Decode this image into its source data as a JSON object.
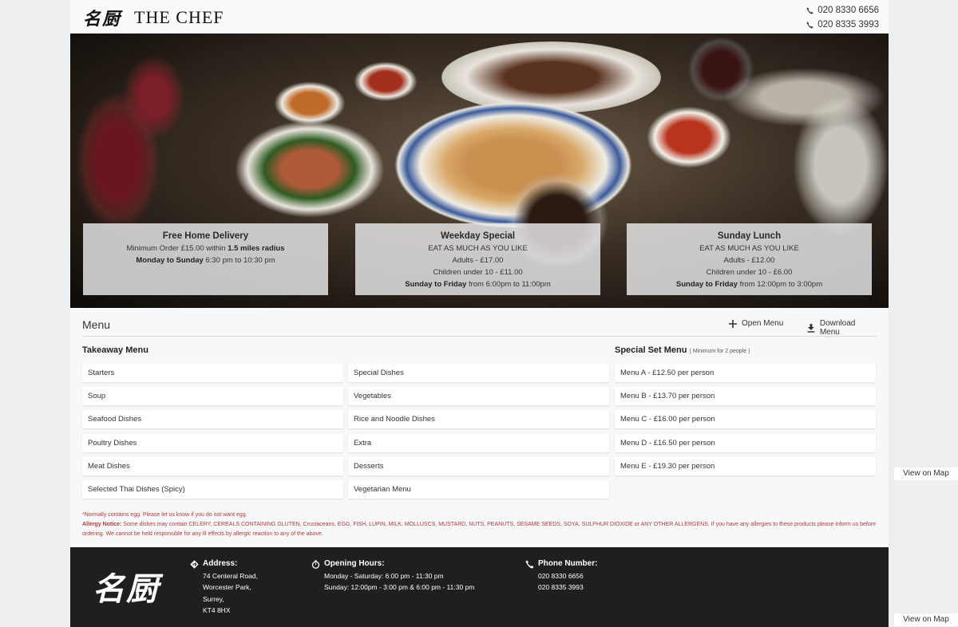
{
  "header": {
    "logo_cn": "名厨",
    "logo_en": "THE CHEF",
    "phones": [
      "020 8330 6656",
      "020 8335 3993"
    ]
  },
  "cards": [
    {
      "title": "Free Home Delivery",
      "line1_pre": "Minimum Order £15.00 within ",
      "line1_bold": "1.5 miles radius",
      "line2_bold": "Monday to Sunday",
      "line2_rest": " 6:30 pm to 10:30 pm"
    },
    {
      "title": "Weekday Special",
      "line1": "EAT AS MUCH AS YOU LIKE",
      "line2": "Adults - £17.00",
      "line3": "Children under 10 - £11.00",
      "line4_bold": "Sunday to Friday",
      "line4_rest": " from 6:00pm to 11:00pm"
    },
    {
      "title": "Sunday Lunch",
      "line1": "EAT AS MUCH AS YOU LIKE",
      "line2": "Adults - £12.00",
      "line3": "Children under 10 - £6.00",
      "line4_bold": "Sunday to Friday",
      "line4_rest": " from 12:00pm to 3:00pm"
    }
  ],
  "menu": {
    "title": "Menu",
    "open_label": "Open Menu",
    "download_label": "Download Menu",
    "takeaway_title": "Takeaway Menu",
    "takeaway_col1": [
      "Starters",
      "Soup",
      "Seafood Dishes",
      "Poultry Dishes",
      "Meat Dishes",
      "Selected Thai Dishes (Spicy)"
    ],
    "takeaway_col2": [
      "Special Dishes",
      "Vegetables",
      "Rice and Noodle Dishes",
      "Extra",
      "Desserts",
      "Vegetarian Menu"
    ],
    "set_title": "Special Set Menu",
    "set_note": "( Minimum for 2 people )",
    "set_items": [
      "Menu A - £12.50 per person",
      "Menu B - £13.70 per person",
      "Menu C - £16.00 per person",
      "Menu D - £16.50 per person",
      "Menu E - £19.30 per person"
    ]
  },
  "notes": {
    "egg": "*Normally contains egg. Please let us know if you do not want egg.",
    "allergy_label": "Allergy Notice:",
    "allergy_pre": " Some dishes may contain ",
    "allergy_list": "CELERY, CEREALS CONTAINING GLUTEN",
    "allergy_mid": ", Crustaceans, ",
    "allergy_list2": "EGG, FISH, LUPIN, MILK, MOLLUSCS, MUSTARD, NUTS, PEANUTS, SESAME SEEDS, SOYA, SULPHUR DIOXIDE",
    "allergy_or": " or ",
    "allergy_list3": "ANY OTHER ALLERGENS",
    "allergy_rest": ". If you have any allergies to these products please inform us before ordering. We cannot be held responsible for any ill effects by allergic reaction to any of the above."
  },
  "footer": {
    "logo_cn": "名厨",
    "address_label": "Address:",
    "address_lines": [
      "74 Centeral Road,",
      "Worcester Park,",
      "Surrey,",
      "KT4 8HX"
    ],
    "hours_label": "Opening Hours:",
    "hours_lines": [
      "Monday - Saturday: 6:00 pm - 11:30 pm",
      "Sunday: 12:00pm - 3:00 pm & 6:00 pm - 11:30 pm"
    ],
    "phone_label": "Phone Number:",
    "phone_lines": [
      "020 8330 6656",
      "020 8335 3993"
    ]
  },
  "map_button": "View on Map",
  "colors": {
    "allergy_text": "#b03a3a",
    "footer_bg": "#1d1f21"
  }
}
